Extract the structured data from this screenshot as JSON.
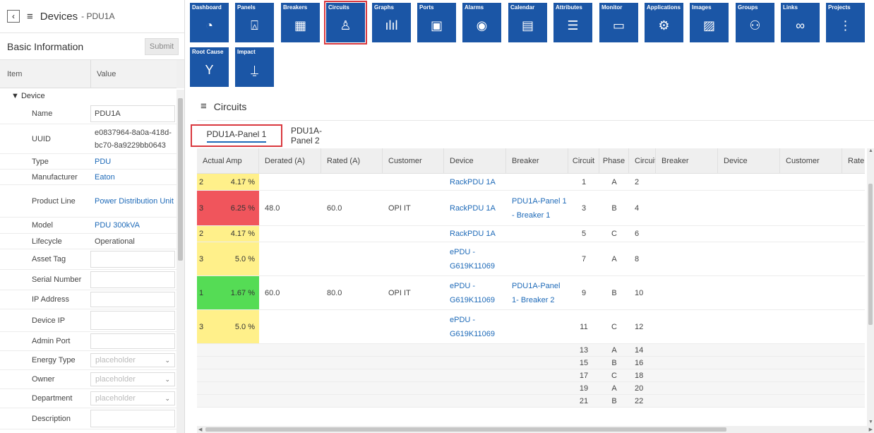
{
  "left_panel": {
    "back_icon": "‹",
    "menu_icon": "≡",
    "title": "Devices",
    "subtitle": "- PDU1A",
    "section_title": "Basic Information",
    "submit_label": "Submit",
    "col_item": "Item",
    "col_value": "Value",
    "group_label": "▼ Device",
    "fields": [
      {
        "key": "Name",
        "value": "PDU1A",
        "link": false,
        "kind": "text",
        "h": 29
      },
      {
        "key": "UUID",
        "value": "e0837964-8a0a-418d-bc70-8a9229bb0643",
        "link": false,
        "kind": "text",
        "h": 42
      },
      {
        "key": "Type",
        "value": "PDU",
        "link": true,
        "kind": "text",
        "h": 22
      },
      {
        "key": "Manufacturer",
        "value": "Eaton",
        "link": true,
        "kind": "text",
        "h": 22
      },
      {
        "key": "Product Line",
        "value": "Power Distribution Unit",
        "link": true,
        "kind": "text",
        "h": 46
      },
      {
        "key": "Model",
        "value": "PDU 300kVA",
        "link": true,
        "kind": "text",
        "h": 23
      },
      {
        "key": "Lifecycle",
        "value": "Operational",
        "link": false,
        "kind": "text",
        "h": 22
      },
      {
        "key": "Asset Tag",
        "value": "",
        "link": false,
        "kind": "box",
        "h": 29
      },
      {
        "key": "Serial Number",
        "value": "",
        "link": false,
        "kind": "box",
        "h": 29
      },
      {
        "key": "IP Address",
        "value": "",
        "link": false,
        "kind": "box",
        "h": 27
      },
      {
        "key": "Device IP",
        "value": "",
        "link": false,
        "kind": "box",
        "h": 32
      },
      {
        "key": "Admin Port",
        "value": "",
        "link": false,
        "kind": "box",
        "h": 27
      },
      {
        "key": "Energy Type",
        "value": "placeholder",
        "link": false,
        "kind": "select",
        "h": 27
      },
      {
        "key": "Owner",
        "value": "placeholder",
        "link": false,
        "kind": "select",
        "h": 27
      },
      {
        "key": "Department",
        "value": "placeholder",
        "link": false,
        "kind": "select",
        "h": 27
      },
      {
        "key": "Description",
        "value": "",
        "link": false,
        "kind": "box",
        "h": 30
      }
    ]
  },
  "toolbar": {
    "items": [
      {
        "label": "Dashboard",
        "icon": "◔",
        "name": "dashboard"
      },
      {
        "label": "Panels",
        "icon": "⍓",
        "name": "panels"
      },
      {
        "label": "Breakers",
        "icon": "▦",
        "name": "breakers"
      },
      {
        "label": "Circuits",
        "icon": "♙",
        "name": "circuits",
        "active": true
      },
      {
        "label": "Graphs",
        "icon": "ılıl",
        "name": "graphs"
      },
      {
        "label": "Ports",
        "icon": "▣",
        "name": "ports"
      },
      {
        "label": "Alarms",
        "icon": "◉",
        "name": "alarms"
      },
      {
        "label": "Calendar",
        "icon": "▤",
        "name": "calendar"
      },
      {
        "label": "Attributes",
        "icon": "☰",
        "name": "attributes"
      },
      {
        "label": "Monitor",
        "icon": "▭",
        "name": "monitor"
      },
      {
        "label": "Applications",
        "icon": "⚙",
        "name": "applications"
      },
      {
        "label": "Images",
        "icon": "▨",
        "name": "images"
      },
      {
        "label": "Groups",
        "icon": "⚇",
        "name": "groups"
      },
      {
        "label": "Links",
        "icon": "∞",
        "name": "links"
      },
      {
        "label": "Projects",
        "icon": "⋮",
        "name": "projects"
      },
      {
        "label": "Root Cause",
        "icon": "Y",
        "name": "root-cause"
      },
      {
        "label": "Impact",
        "icon": "⍊",
        "name": "impact"
      }
    ]
  },
  "main": {
    "menu_icon": "≡",
    "title": "Circuits",
    "tabs": [
      {
        "label": "PDU1A-Panel 1",
        "active": true
      },
      {
        "label": "PDU1A-Panel 2",
        "active": false
      }
    ],
    "columns": [
      "Actual Amp",
      "Derated (A)",
      "Rated (A)",
      "Customer",
      "Device",
      "Breaker",
      "Circuit",
      "Phase",
      "Circuit",
      "Breaker",
      "Device",
      "Customer",
      "Rate"
    ],
    "rows": [
      {
        "amp_n": "2",
        "amp_p": "4.17 %",
        "amp_color": "yellow",
        "derated": "",
        "rated": "",
        "customer": "",
        "device": "RackPDU 1A",
        "breaker": "",
        "circuit": "1",
        "phase": "A",
        "circuit2": "2",
        "h": 24
      },
      {
        "amp_n": "3",
        "amp_p": "6.25 %",
        "amp_color": "red",
        "derated": "48.0",
        "rated": "60.0",
        "customer": "OPI IT",
        "device": "RackPDU 1A",
        "breaker": "PDU1A-Panel 1 - Breaker 1",
        "circuit": "3",
        "phase": "B",
        "circuit2": "4",
        "h": 50
      },
      {
        "amp_n": "2",
        "amp_p": "4.17 %",
        "amp_color": "yellow",
        "derated": "",
        "rated": "",
        "customer": "",
        "device": "RackPDU 1A",
        "breaker": "",
        "circuit": "5",
        "phase": "C",
        "circuit2": "6",
        "h": 23
      },
      {
        "amp_n": "3",
        "amp_p": "5.0 %",
        "amp_color": "yellow",
        "derated": "",
        "rated": "",
        "customer": "",
        "device": "ePDU - G619K11069",
        "breaker": "",
        "circuit": "7",
        "phase": "A",
        "circuit2": "8",
        "h": 48
      },
      {
        "amp_n": "1",
        "amp_p": "1.67 %",
        "amp_color": "green",
        "derated": "60.0",
        "rated": "80.0",
        "customer": "OPI IT",
        "device": "ePDU - G619K11069",
        "breaker": "PDU1A-Panel 1- Breaker 2",
        "circuit": "9",
        "phase": "B",
        "circuit2": "10",
        "h": 48
      },
      {
        "amp_n": "3",
        "amp_p": "5.0 %",
        "amp_color": "yellow",
        "derated": "",
        "rated": "",
        "customer": "",
        "device": "ePDU - G619K11069",
        "breaker": "",
        "circuit": "11",
        "phase": "C",
        "circuit2": "12",
        "h": 48
      },
      {
        "amp_n": "",
        "amp_p": "",
        "amp_color": "",
        "derated": "",
        "rated": "",
        "customer": "",
        "device": "",
        "breaker": "",
        "circuit": "13",
        "phase": "A",
        "circuit2": "14",
        "h": 18
      },
      {
        "amp_n": "",
        "amp_p": "",
        "amp_color": "",
        "derated": "",
        "rated": "",
        "customer": "",
        "device": "",
        "breaker": "",
        "circuit": "15",
        "phase": "B",
        "circuit2": "16",
        "h": 18
      },
      {
        "amp_n": "",
        "amp_p": "",
        "amp_color": "",
        "derated": "",
        "rated": "",
        "customer": "",
        "device": "",
        "breaker": "",
        "circuit": "17",
        "phase": "C",
        "circuit2": "18",
        "h": 18
      },
      {
        "amp_n": "",
        "amp_p": "",
        "amp_color": "",
        "derated": "",
        "rated": "",
        "customer": "",
        "device": "",
        "breaker": "",
        "circuit": "19",
        "phase": "A",
        "circuit2": "20",
        "h": 18
      },
      {
        "amp_n": "",
        "amp_p": "",
        "amp_color": "",
        "derated": "",
        "rated": "",
        "customer": "",
        "device": "",
        "breaker": "",
        "circuit": "21",
        "phase": "B",
        "circuit2": "22",
        "h": 18
      }
    ]
  },
  "colors": {
    "toolbar_bg": "#1b56a6",
    "link": "#1e6ab8",
    "highlight": "#d9383e",
    "amp_yellow": "#fff08a",
    "amp_red": "#f0555c",
    "amp_green": "#55dc55"
  }
}
